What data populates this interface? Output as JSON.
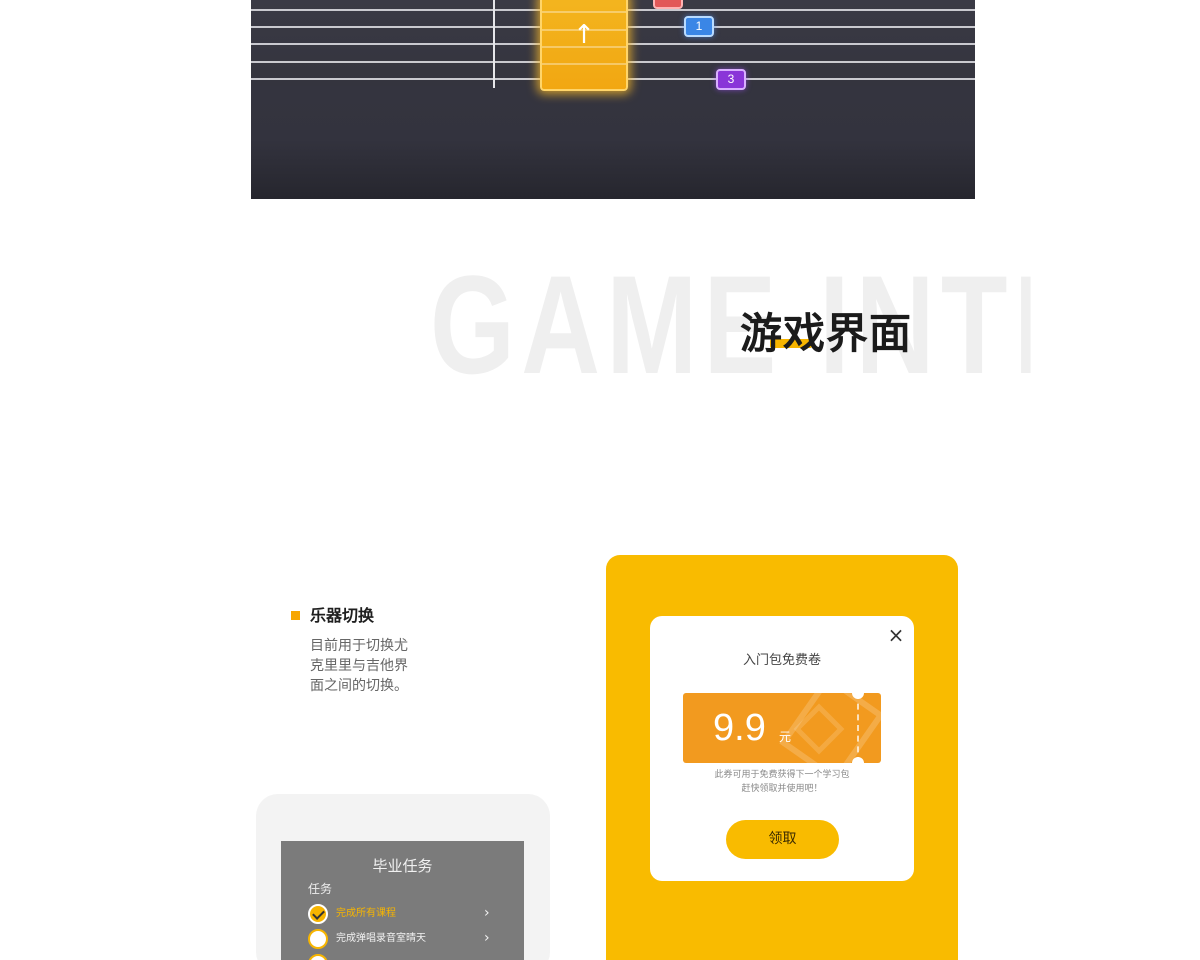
{
  "game_board": {
    "note_arrow": "↑",
    "tags": [
      {
        "label": "",
        "color": "#e25858"
      },
      {
        "label": "1",
        "color": "#3a86e6"
      },
      {
        "label": "3",
        "color": "#8a35d8"
      }
    ]
  },
  "section": {
    "background_word": "GAME INTERF",
    "title": "游戏界面",
    "accent_color": "#f7b500"
  },
  "feature": {
    "title": "乐器切换",
    "description_lines": [
      "目前用于切换尤",
      "克里里与吉他界",
      "面之间的切换。"
    ]
  },
  "task_card": {
    "title": "毕业任务",
    "subhead": "任务",
    "tasks": [
      {
        "label": "完成所有课程",
        "done": true
      },
      {
        "label": "完成弹唱录音室晴天",
        "done": false
      },
      {
        "label": "",
        "done": false
      }
    ],
    "chevron": "›"
  },
  "coupon": {
    "title": "入门包免费卷",
    "price": "9.9",
    "unit": "元",
    "note_lines": [
      "此券可用于免费获得下一个学习包",
      "赶快领取并使用吧！"
    ],
    "claim_label": "领取",
    "close_icon": "×",
    "brand_color": "#f9bb00",
    "ticket_color": "#f29a1f"
  }
}
